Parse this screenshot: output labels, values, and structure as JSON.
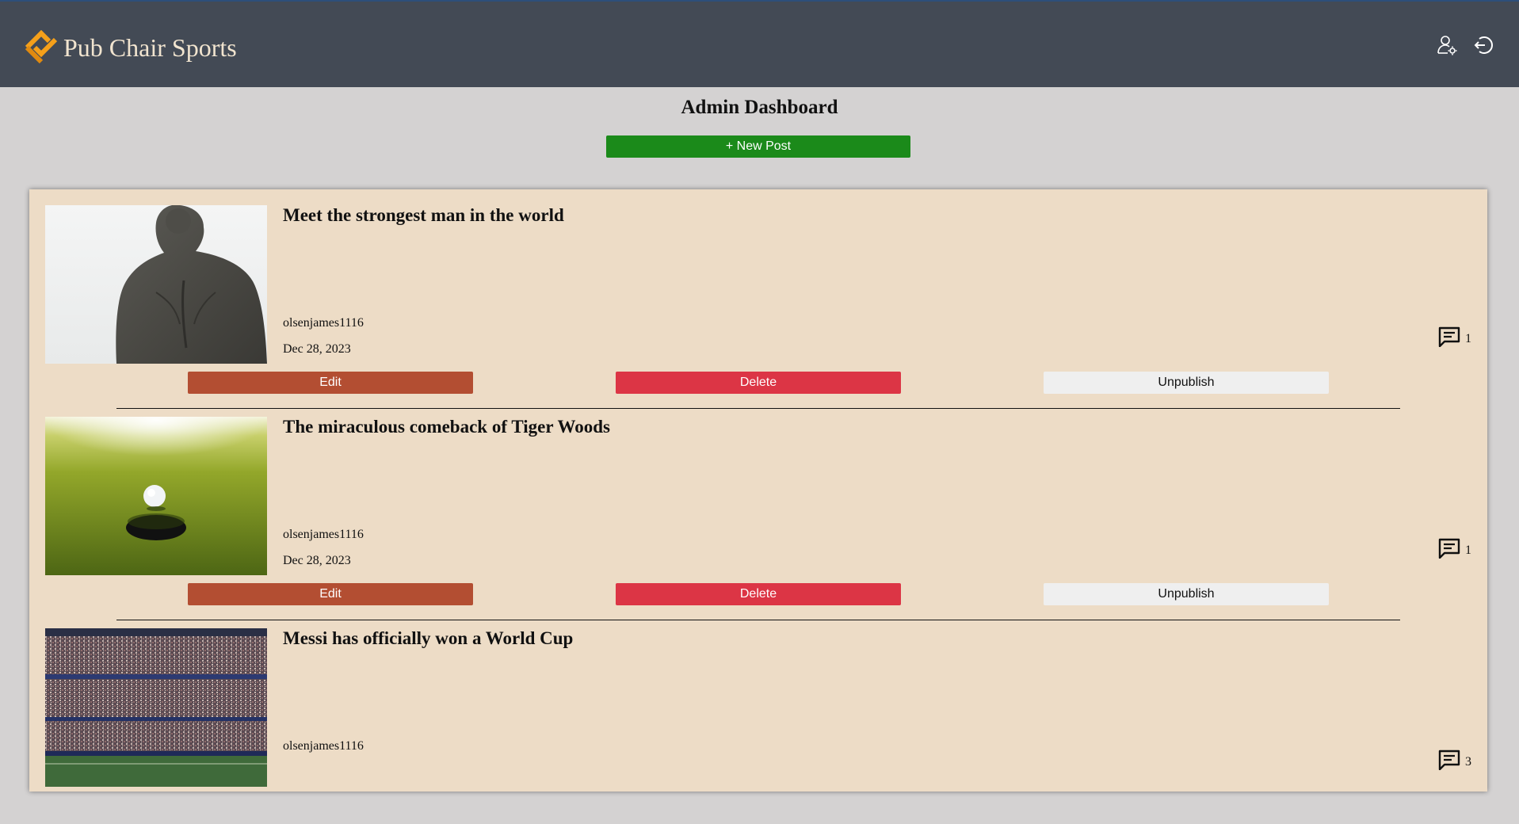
{
  "header": {
    "brand": "Pub Chair Sports",
    "icons": [
      "brand-logo-icon",
      "user-settings-icon",
      "logout-icon"
    ]
  },
  "page": {
    "title": "Admin Dashboard",
    "new_post_label": "+ New Post"
  },
  "posts": [
    {
      "title": "Meet the strongest man in the world",
      "author": "olsenjames1116",
      "date": "Dec 28, 2023",
      "comments": "1",
      "image": "statue-back"
    },
    {
      "title": "The miraculous comeback of Tiger Woods",
      "author": "olsenjames1116",
      "date": "Dec 28, 2023",
      "comments": "1",
      "image": "golf-ball-hole"
    },
    {
      "title": "Messi has officially won a World Cup",
      "author": "olsenjames1116",
      "date": "",
      "comments": "3",
      "image": "stadium-crowd"
    }
  ],
  "actions": {
    "edit": "Edit",
    "delete": "Delete",
    "unpublish": "Unpublish"
  },
  "colors": {
    "header_bg": "#434a55",
    "page_bg": "#d4d2d2",
    "panel_bg": "#eddcc6",
    "new_post": "#1b8a1a",
    "edit": "#b34e32",
    "delete": "#dc3545",
    "brand_accent": "#f5a01a"
  }
}
